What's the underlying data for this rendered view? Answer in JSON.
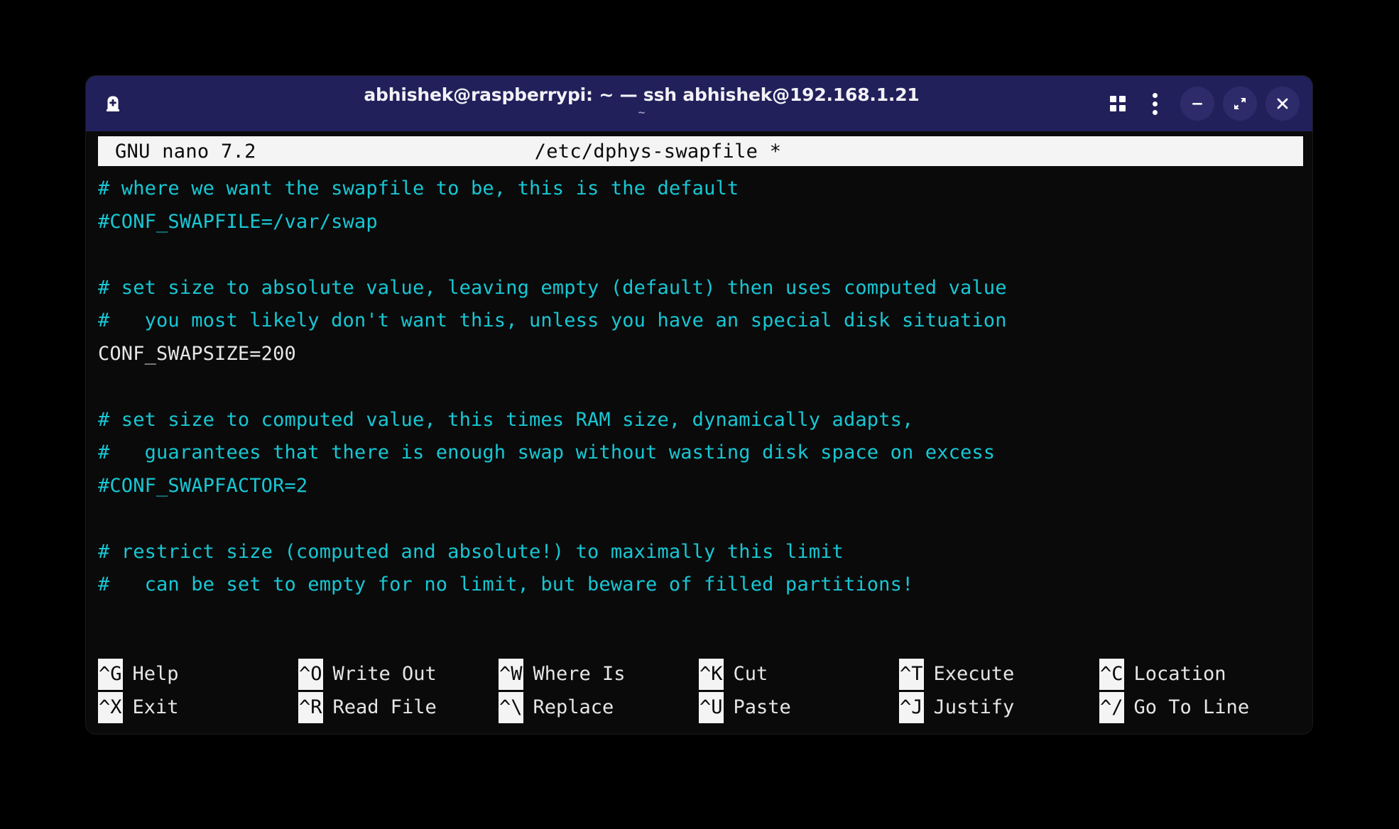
{
  "window": {
    "title": "abhishek@raspberrypi: ~ — ssh abhishek@192.168.1.21",
    "subtitle": "~",
    "titlebar_color": "#22205a",
    "new_tab_icon": "new-tab-icon",
    "grid_icon": "grid-view-icon",
    "menu_icon": "kebab-menu-icon",
    "minimize_label": "−",
    "maximize_label": "⤢",
    "close_label": "✕"
  },
  "nano": {
    "version": "GNU nano 7.2",
    "filename": "/etc/dphys-swapfile *",
    "comment_color": "#17c7d4",
    "text_color": "#e6e6e6",
    "lines": [
      {
        "type": "comment",
        "text": "# where we want the swapfile to be, this is the default"
      },
      {
        "type": "comment",
        "text": "#CONF_SWAPFILE=/var/swap"
      },
      {
        "type": "blank",
        "text": ""
      },
      {
        "type": "comment",
        "text": "# set size to absolute value, leaving empty (default) then uses computed value"
      },
      {
        "type": "comment",
        "text": "#   you most likely don't want this, unless you have an special disk situation"
      },
      {
        "type": "code",
        "text": "CONF_SWAPSIZE=200"
      },
      {
        "type": "blank",
        "text": ""
      },
      {
        "type": "comment",
        "text": "# set size to computed value, this times RAM size, dynamically adapts,"
      },
      {
        "type": "comment",
        "text": "#   guarantees that there is enough swap without wasting disk space on excess"
      },
      {
        "type": "comment",
        "text": "#CONF_SWAPFACTOR=2"
      },
      {
        "type": "blank",
        "text": ""
      },
      {
        "type": "comment",
        "text": "# restrict size (computed and absolute!) to maximally this limit"
      },
      {
        "type": "comment",
        "text": "#   can be set to empty for no limit, but beware of filled partitions!"
      }
    ],
    "shortcuts_row1": [
      {
        "key": "^G",
        "label": "Help"
      },
      {
        "key": "^O",
        "label": "Write Out"
      },
      {
        "key": "^W",
        "label": "Where Is"
      },
      {
        "key": "^K",
        "label": "Cut"
      },
      {
        "key": "^T",
        "label": "Execute"
      },
      {
        "key": "^C",
        "label": "Location"
      }
    ],
    "shortcuts_row2": [
      {
        "key": "^X",
        "label": "Exit"
      },
      {
        "key": "^R",
        "label": "Read File"
      },
      {
        "key": "^\\",
        "label": "Replace"
      },
      {
        "key": "^U",
        "label": "Paste"
      },
      {
        "key": "^J",
        "label": "Justify"
      },
      {
        "key": "^/",
        "label": "Go To Line"
      }
    ]
  }
}
